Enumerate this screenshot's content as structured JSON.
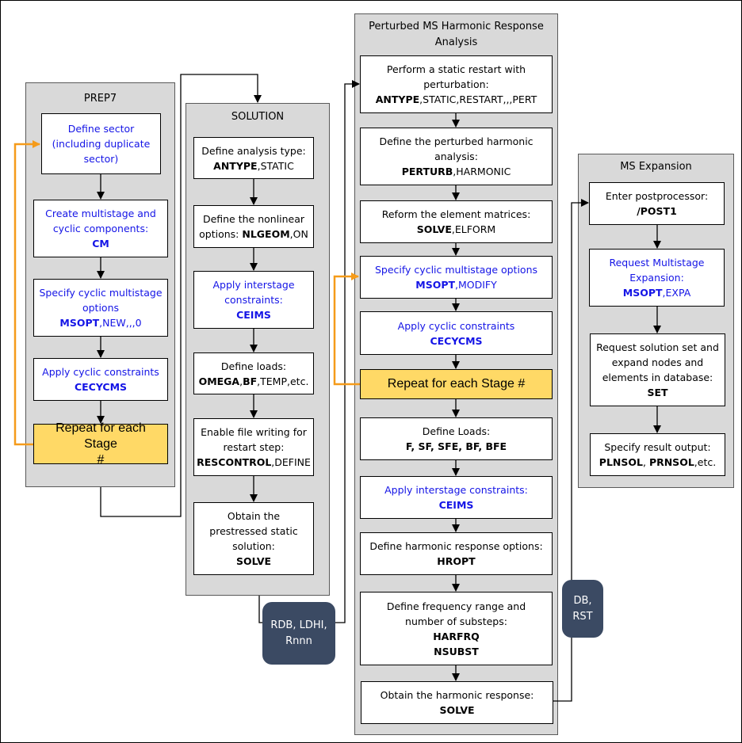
{
  "panels": {
    "prep7": {
      "title": "PREP7",
      "nodes": [
        {
          "lines": [
            "Define sector",
            "(including duplicate",
            "sector)"
          ]
        },
        {
          "lines": [
            "Create multistage and",
            "cyclic components:"
          ],
          "cmd_bold": "CM",
          "cmd_rest": ""
        },
        {
          "lines": [
            "Specify cyclic multistage",
            "options"
          ],
          "cmd_bold": "MSOPT",
          "cmd_rest": ",NEW,,,0"
        },
        {
          "lines": [
            "Apply cyclic constraints"
          ],
          "cmd_bold": "CECYCMS",
          "cmd_rest": ""
        },
        {
          "lines": [
            "Repeat for each Stage",
            "#"
          ]
        }
      ]
    },
    "solution": {
      "title": "SOLUTION",
      "nodes": [
        {
          "lines": [
            "Define analysis type:"
          ],
          "cmd_bold": "ANTYPE",
          "cmd_rest": ",STATIC"
        },
        {
          "lines": [
            "Define the nonlinear"
          ],
          "prefix": "options: ",
          "cmd_bold": "NLGEOM",
          "cmd_rest": ",ON"
        },
        {
          "lines": [
            "Apply interstage",
            "constraints:"
          ],
          "cmd_bold": "CEIMS",
          "cmd_rest": ""
        },
        {
          "lines": [
            "Define loads:"
          ],
          "cmd_bold": "OMEGA",
          "cmd_mid": ",",
          "cmd_bold2": "BF",
          "cmd_rest": ",TEMP,etc."
        },
        {
          "lines": [
            "Enable file writing for",
            "restart step:"
          ],
          "cmd_bold": "RESCONTROL",
          "cmd_rest": ",DEFINE"
        },
        {
          "lines": [
            "Obtain the",
            "prestressed static",
            "solution:"
          ],
          "cmd_bold": "SOLVE",
          "cmd_rest": ""
        }
      ]
    },
    "harmonic": {
      "title_lines": [
        "Perturbed MS Harmonic Response",
        "Analysis"
      ],
      "nodes": [
        {
          "lines": [
            "Perform a static restart with",
            "perturbation:"
          ],
          "cmd_bold": "ANTYPE",
          "cmd_rest": ",STATIC,RESTART,,,PERT"
        },
        {
          "lines": [
            "Define the perturbed harmonic",
            "analysis:"
          ],
          "cmd_bold": "PERTURB",
          "cmd_rest": ",HARMONIC"
        },
        {
          "lines": [
            "Reform the element matrices:"
          ],
          "cmd_bold": "SOLVE",
          "cmd_rest": ",ELFORM"
        },
        {
          "lines": [
            "Specify cyclic multistage options"
          ],
          "cmd_bold": "MSOPT",
          "cmd_rest": ",MODIFY"
        },
        {
          "lines": [
            "Apply cyclic constraints"
          ],
          "cmd_bold": "CECYCMS",
          "cmd_rest": ""
        },
        {
          "lines": [
            "Repeat for each Stage #"
          ]
        },
        {
          "lines": [
            "Define Loads:"
          ],
          "cmd_bold": "F, SF, SFE, BF, BFE",
          "cmd_rest": ""
        },
        {
          "lines": [
            "Apply interstage constraints:"
          ],
          "cmd_bold": "CEIMS",
          "cmd_rest": ""
        },
        {
          "lines": [
            "Define harmonic response options:"
          ],
          "cmd_bold": "HROPT",
          "cmd_rest": ""
        },
        {
          "lines": [
            "Define frequency range and",
            "number of substeps:"
          ],
          "cmd_bold": "HARFRQ",
          "cmd_bold_line2": "NSUBST",
          "cmd_rest": ""
        },
        {
          "lines": [
            "Obtain the harmonic response:"
          ],
          "cmd_bold": "SOLVE",
          "cmd_rest": ""
        }
      ]
    },
    "expansion": {
      "title": "MS Expansion",
      "nodes": [
        {
          "lines": [
            "Enter postprocessor:"
          ],
          "cmd_bold": "/POST1",
          "cmd_rest": ""
        },
        {
          "lines": [
            "Request Multistage",
            "Expansion:"
          ],
          "cmd_bold": "MSOPT",
          "cmd_rest": ",EXPA"
        },
        {
          "lines": [
            "Request solution set and",
            "expand nodes and",
            "elements in database:"
          ],
          "cmd_bold": "SET",
          "cmd_rest": ""
        },
        {
          "lines": [
            "Specify result output:"
          ],
          "cmd_bold": "PLNSOL",
          "cmd_mid": ", ",
          "cmd_bold2": "PRNSOL",
          "cmd_rest": ",etc."
        }
      ]
    }
  },
  "files": {
    "restart_files": [
      "RDB, LDHI,",
      "Rnnn"
    ],
    "result_files": [
      "DB,",
      "RST"
    ]
  },
  "colors": {
    "panel_bg": "#d9d9d9",
    "blue_text": "#1414e6",
    "repeat_fill": "#ffd966",
    "loop_arrow": "#f59b1a",
    "file_badge": "#3b4a63"
  }
}
